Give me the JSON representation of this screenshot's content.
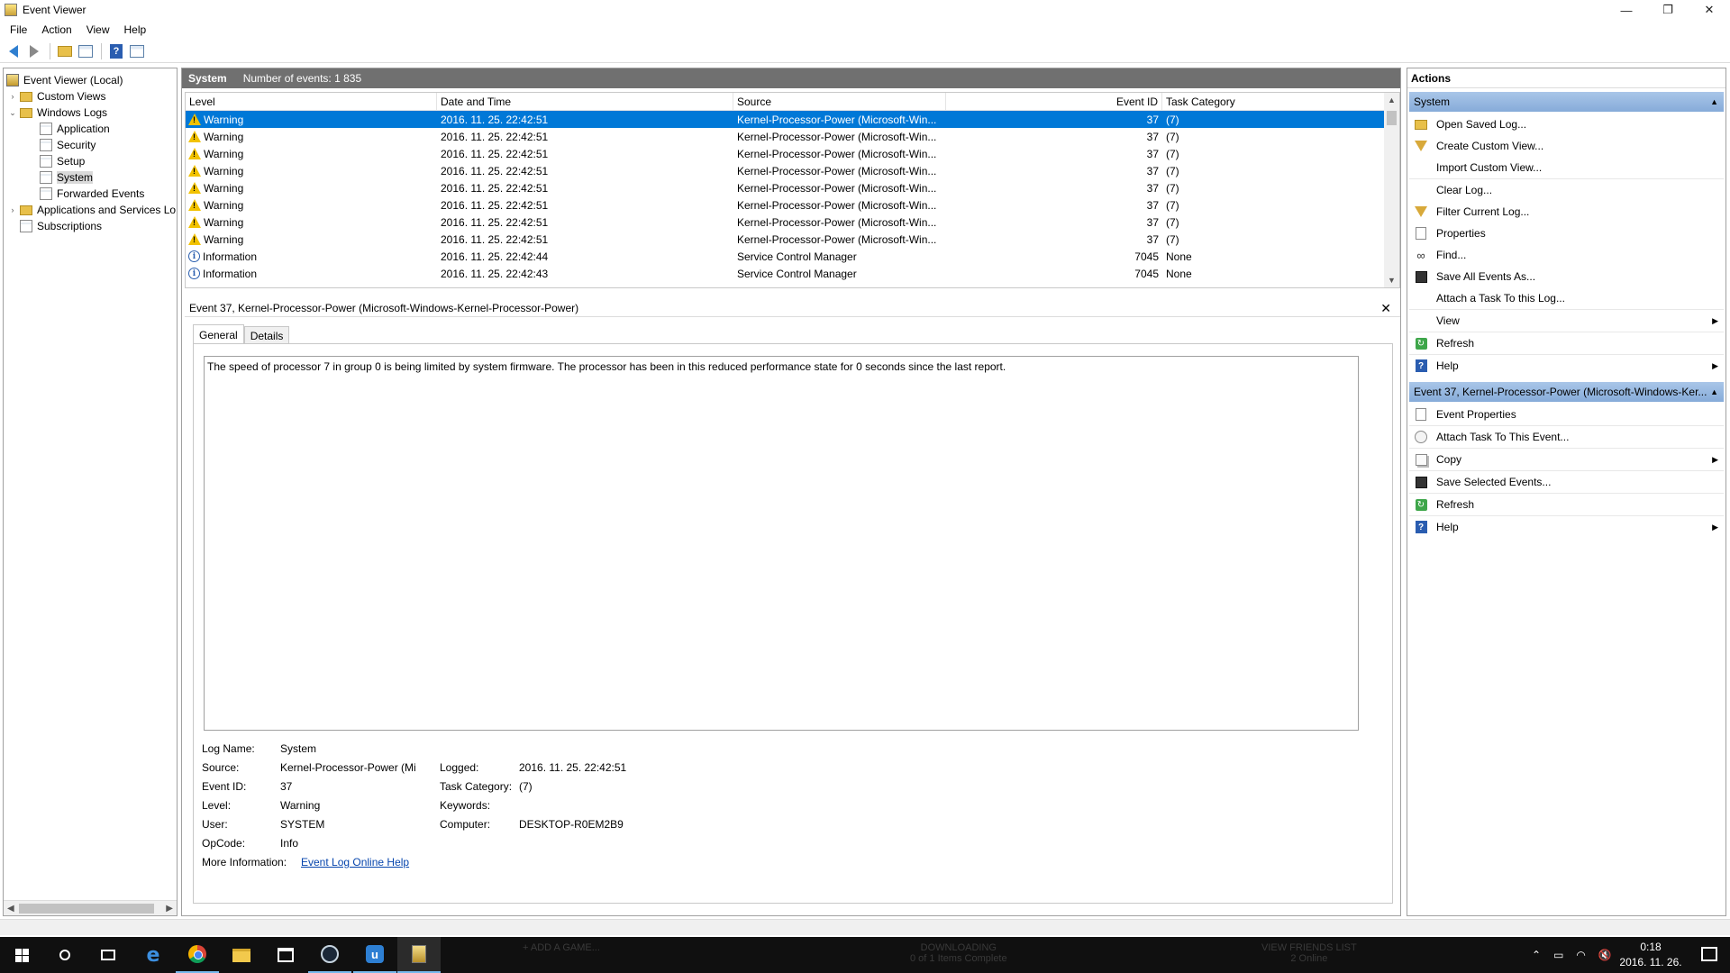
{
  "window": {
    "title": "Event Viewer",
    "minimize": "—",
    "restore": "❐",
    "close": "✕"
  },
  "menu": [
    "File",
    "Action",
    "View",
    "Help"
  ],
  "toolbar": {
    "icons": [
      "back-arrow-icon",
      "forward-arrow-icon",
      "open-folder-icon",
      "show-hide-tree-icon",
      "help-icon",
      "show-hide-action-pane-icon"
    ]
  },
  "tree": {
    "items": [
      {
        "label": "Event Viewer (Local)",
        "icon": "event-viewer-icon",
        "level": 0,
        "expander": ""
      },
      {
        "label": "Custom Views",
        "icon": "folder-icon",
        "level": 1,
        "expander": "›"
      },
      {
        "label": "Windows Logs",
        "icon": "folder-icon",
        "level": 1,
        "expander": "⌄"
      },
      {
        "label": "Application",
        "icon": "log-icon",
        "level": 2,
        "expander": ""
      },
      {
        "label": "Security",
        "icon": "log-icon",
        "level": 2,
        "expander": ""
      },
      {
        "label": "Setup",
        "icon": "log-icon",
        "level": 2,
        "expander": ""
      },
      {
        "label": "System",
        "icon": "log-icon",
        "level": 2,
        "expander": "",
        "selected": true
      },
      {
        "label": "Forwarded Events",
        "icon": "log-icon",
        "level": 2,
        "expander": ""
      },
      {
        "label": "Applications and Services Lo",
        "icon": "folder-icon",
        "level": 1,
        "expander": "›"
      },
      {
        "label": "Subscriptions",
        "icon": "subscriptions-icon",
        "level": 1,
        "expander": ""
      }
    ]
  },
  "center": {
    "log_name": "System",
    "event_count": "Number of events: 1 835",
    "columns": [
      "Level",
      "Date and Time",
      "Source",
      "Event ID",
      "Task Category"
    ],
    "rows": [
      {
        "level": "Warning",
        "date": "2016. 11. 25. 22:42:51",
        "source": "Kernel-Processor-Power (Microsoft-Win...",
        "event_id": "37",
        "task": "(7)",
        "selected": true
      },
      {
        "level": "Warning",
        "date": "2016. 11. 25. 22:42:51",
        "source": "Kernel-Processor-Power (Microsoft-Win...",
        "event_id": "37",
        "task": "(7)"
      },
      {
        "level": "Warning",
        "date": "2016. 11. 25. 22:42:51",
        "source": "Kernel-Processor-Power (Microsoft-Win...",
        "event_id": "37",
        "task": "(7)"
      },
      {
        "level": "Warning",
        "date": "2016. 11. 25. 22:42:51",
        "source": "Kernel-Processor-Power (Microsoft-Win...",
        "event_id": "37",
        "task": "(7)"
      },
      {
        "level": "Warning",
        "date": "2016. 11. 25. 22:42:51",
        "source": "Kernel-Processor-Power (Microsoft-Win...",
        "event_id": "37",
        "task": "(7)"
      },
      {
        "level": "Warning",
        "date": "2016. 11. 25. 22:42:51",
        "source": "Kernel-Processor-Power (Microsoft-Win...",
        "event_id": "37",
        "task": "(7)"
      },
      {
        "level": "Warning",
        "date": "2016. 11. 25. 22:42:51",
        "source": "Kernel-Processor-Power (Microsoft-Win...",
        "event_id": "37",
        "task": "(7)"
      },
      {
        "level": "Warning",
        "date": "2016. 11. 25. 22:42:51",
        "source": "Kernel-Processor-Power (Microsoft-Win...",
        "event_id": "37",
        "task": "(7)"
      },
      {
        "level": "Information",
        "date": "2016. 11. 25. 22:42:44",
        "source": "Service Control Manager",
        "event_id": "7045",
        "task": "None"
      },
      {
        "level": "Information",
        "date": "2016. 11. 25. 22:42:43",
        "source": "Service Control Manager",
        "event_id": "7045",
        "task": "None"
      }
    ]
  },
  "detail": {
    "title": "Event 37, Kernel-Processor-Power (Microsoft-Windows-Kernel-Processor-Power)",
    "close": "✕",
    "tabs": [
      "General",
      "Details"
    ],
    "message": "The speed of processor 7 in group 0 is being limited by system firmware. The processor has been in this reduced performance state for 0 seconds since the last report.",
    "labels": {
      "log_name": "Log Name:",
      "source": "Source:",
      "event_id": "Event ID:",
      "level": "Level:",
      "user": "User:",
      "opcode": "OpCode:",
      "more_info": "More Information:",
      "logged": "Logged:",
      "task_category": "Task Category:",
      "keywords": "Keywords:",
      "computer": "Computer:"
    },
    "values": {
      "log_name": "System",
      "source": "Kernel-Processor-Power (Mi",
      "event_id": "37",
      "level": "Warning",
      "user": "SYSTEM",
      "opcode": "Info",
      "more_info": "Event Log Online Help",
      "logged": "2016. 11. 25. 22:42:51",
      "task_category": "(7)",
      "keywords": "",
      "computer": "DESKTOP-R0EM2B9"
    }
  },
  "actions": {
    "header": "Actions",
    "section1": "System",
    "section1_items": [
      {
        "label": "Open Saved Log...",
        "icon": "open-folder-icon",
        "submenu": false
      },
      {
        "label": "Create Custom View...",
        "icon": "filter-icon",
        "submenu": false
      },
      {
        "label": "Import Custom View...",
        "icon": "",
        "submenu": false
      },
      {
        "label": "Clear Log...",
        "icon": "",
        "submenu": false
      },
      {
        "label": "Filter Current Log...",
        "icon": "filter-icon",
        "submenu": false
      },
      {
        "label": "Properties",
        "icon": "properties-icon",
        "submenu": false
      },
      {
        "label": "Find...",
        "icon": "binoculars-icon",
        "submenu": false
      },
      {
        "label": "Save All Events As...",
        "icon": "save-icon",
        "submenu": false
      },
      {
        "label": "Attach a Task To this Log...",
        "icon": "",
        "submenu": false
      },
      {
        "label": "View",
        "icon": "",
        "submenu": true
      },
      {
        "label": "Refresh",
        "icon": "refresh-icon",
        "submenu": false
      },
      {
        "label": "Help",
        "icon": "help-icon",
        "submenu": true
      }
    ],
    "section2": "Event 37, Kernel-Processor-Power (Microsoft-Windows-Ker...",
    "section2_items": [
      {
        "label": "Event Properties",
        "icon": "properties-icon",
        "submenu": false
      },
      {
        "label": "Attach Task To This Event...",
        "icon": "task-icon",
        "submenu": false
      },
      {
        "label": "Copy",
        "icon": "copy-icon",
        "submenu": true
      },
      {
        "label": "Save Selected Events...",
        "icon": "save-icon",
        "submenu": false
      },
      {
        "label": "Refresh",
        "icon": "refresh-icon",
        "submenu": false
      },
      {
        "label": "Help",
        "icon": "help-icon",
        "submenu": true
      }
    ]
  },
  "taskbar": {
    "ghost_add_game": "+   ADD A GAME...",
    "ghost_downloading": "DOWNLOADING",
    "ghost_downloading_sub": "0 of 1 Items Complete",
    "ghost_friends": "VIEW FRIENDS LIST",
    "ghost_friends_sub": "2 Online",
    "clock_time": "0:18",
    "clock_date": "2016. 11. 26."
  }
}
